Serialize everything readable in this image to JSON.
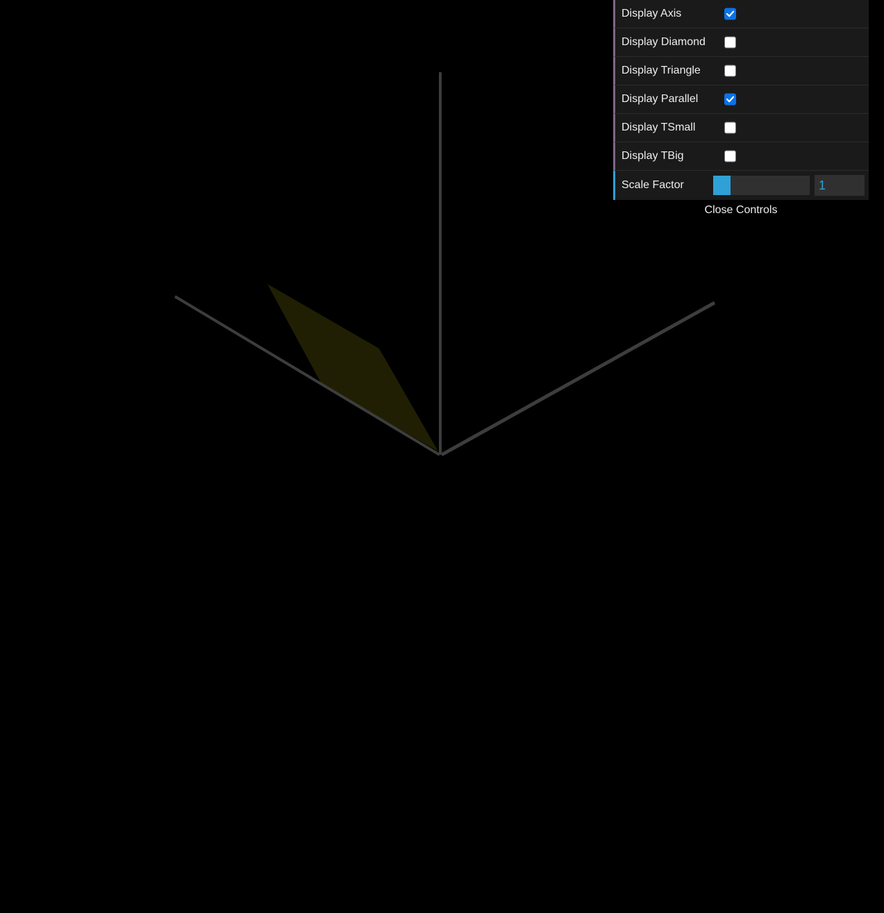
{
  "gui": {
    "controls": [
      {
        "label": "Display Axis",
        "checked": true
      },
      {
        "label": "Display Diamond",
        "checked": false
      },
      {
        "label": "Display Triangle",
        "checked": false
      },
      {
        "label": "Display Parallel",
        "checked": true
      },
      {
        "label": "Display TSmall",
        "checked": false
      },
      {
        "label": "Display TBig",
        "checked": false
      }
    ],
    "scale_factor": {
      "label": "Scale Factor",
      "value": "1",
      "slider_fraction": 0.18
    },
    "close_label": "Close Controls"
  },
  "scene": {
    "background_color": "#000000",
    "axis_color": "#3d3d3d",
    "parallel_color": "#201f04"
  }
}
